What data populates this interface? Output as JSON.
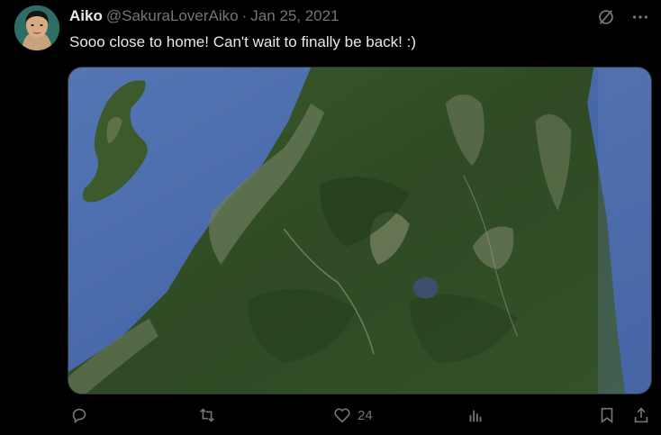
{
  "tweet": {
    "author_name": "Aiko",
    "handle": "@SakuraLoverAiko",
    "separator": "·",
    "date": "Jan 25, 2021",
    "text": "Sooo close to home! Can't wait to finally be back! :)",
    "media_alt": "Satellite image of a mountainous coastline"
  },
  "actions": {
    "reply_count": "",
    "retweet_count": "",
    "like_count": "24",
    "views_count": ""
  },
  "icons": {
    "header": [
      "grok-slash-icon",
      "more-icon"
    ],
    "actions": [
      "reply-icon",
      "retweet-icon",
      "like-icon",
      "views-icon",
      "bookmark-icon",
      "share-icon"
    ]
  },
  "colors": {
    "background": "#000000",
    "text_primary": "#e7e9ea",
    "text_secondary": "#71767b"
  }
}
